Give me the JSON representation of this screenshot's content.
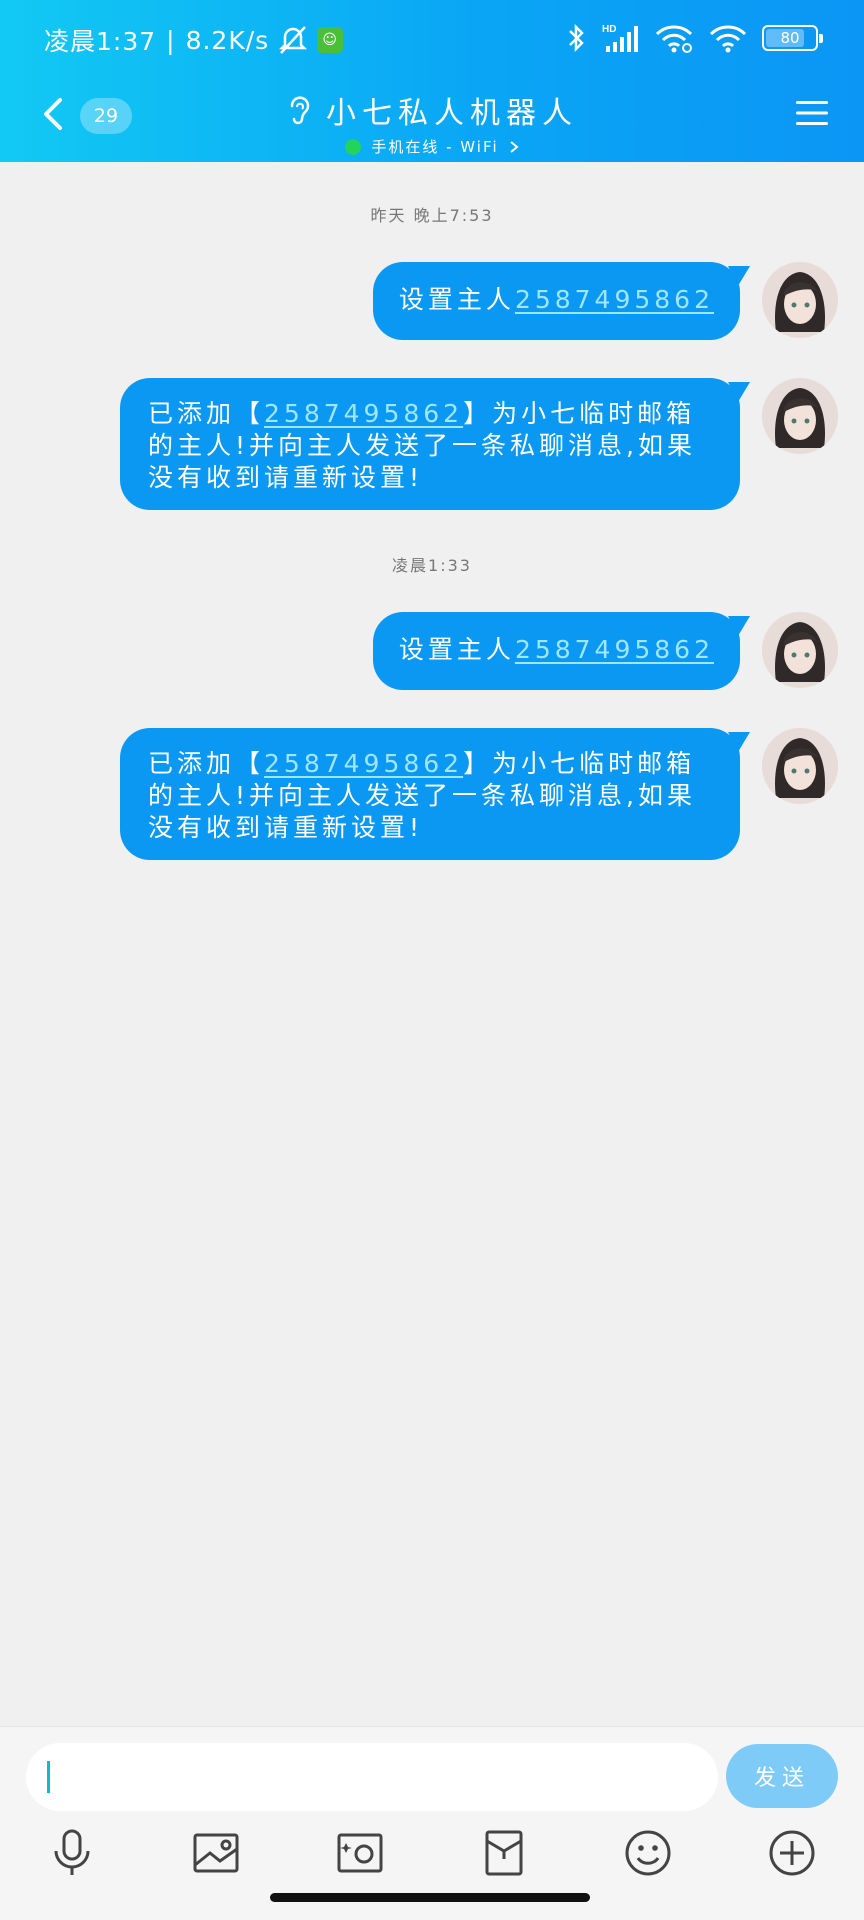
{
  "status_bar": {
    "time": "凌晨1:37",
    "net_speed": "8.2K/s",
    "battery": "80",
    "battery_level_percent": 80,
    "signal": "HD",
    "icons": [
      "mute-bell-icon",
      "app-notification-icon",
      "bluetooth-icon",
      "cellular-signal-icon",
      "wifi-link-icon",
      "wifi-icon",
      "battery-icon"
    ]
  },
  "header": {
    "unread_count": "29",
    "title": "小七私人机器人",
    "subtitle": "手机在线 - WiFi",
    "icons": [
      "back-chevron-icon",
      "ear-icon",
      "menu-icon",
      "chevron-right-icon"
    ]
  },
  "messages": [
    {
      "type": "time",
      "text": "昨天 晚上7:53"
    },
    {
      "type": "msg",
      "prefix": "设置主人",
      "link": "2587495862",
      "suffix": ""
    },
    {
      "type": "msg",
      "prefix": "已添加【",
      "link": "2587495862",
      "suffix": "】为小七临时邮箱的主人!并向主人发送了一条私聊消息,如果没有收到请重新设置!"
    },
    {
      "type": "time",
      "text": "凌晨1:33"
    },
    {
      "type": "msg",
      "prefix": "设置主人",
      "link": "2587495862",
      "suffix": ""
    },
    {
      "type": "msg",
      "prefix": "已添加【",
      "link": "2587495862",
      "suffix": "】为小七临时邮箱的主人!并向主人发送了一条私聊消息,如果没有收到请重新设置!"
    }
  ],
  "input": {
    "value": "",
    "send_label": "发送"
  },
  "toolbar": {
    "icons": [
      "microphone-icon",
      "image-icon",
      "camera-icon",
      "red-packet-icon",
      "emoji-icon",
      "plus-icon"
    ]
  },
  "colors": {
    "header_start": "#12c9f4",
    "header_end": "#0b96f5",
    "bubble": "#0b98f2",
    "send_button": "#7fcbf8",
    "online_dot": "#22d45b"
  }
}
